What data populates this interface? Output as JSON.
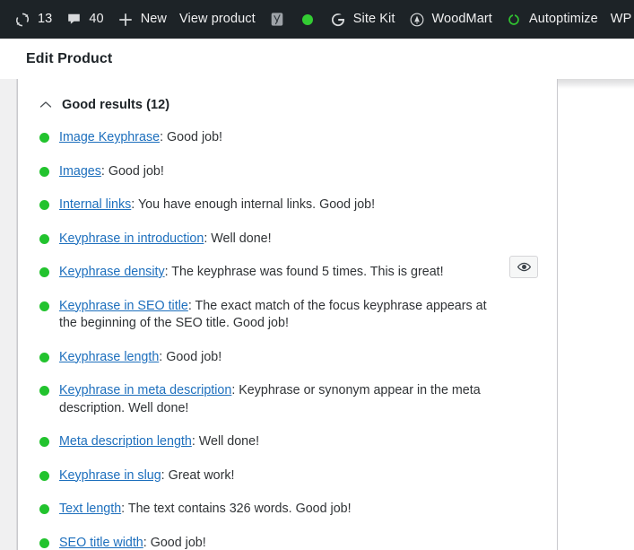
{
  "adminbar": {
    "items": [
      {
        "icon": "wordpress-updates-icon",
        "label": "13",
        "name": "adminbar-updates"
      },
      {
        "icon": "comment-bubble-icon",
        "label": "40",
        "name": "adminbar-comments"
      },
      {
        "icon": "plus-icon",
        "label": "New",
        "name": "adminbar-new"
      },
      {
        "icon": null,
        "label": "View product",
        "name": "adminbar-view-product"
      },
      {
        "icon": "yoast-seo-icon",
        "label": "",
        "name": "adminbar-yoast"
      },
      {
        "icon": "green-dot-icon",
        "label": "",
        "name": "adminbar-seo-score"
      },
      {
        "icon": "google-g-icon",
        "label": "Site Kit",
        "name": "adminbar-site-kit"
      },
      {
        "icon": "woodmart-icon",
        "label": "WoodMart",
        "name": "adminbar-woodmart"
      },
      {
        "icon": "autoptimize-icon",
        "label": "Autoptimize",
        "name": "adminbar-autoptimize"
      },
      {
        "icon": null,
        "label": "WP Rocket",
        "name": "adminbar-wp-rocket"
      }
    ]
  },
  "page": {
    "title": "Edit Product"
  },
  "analysis": {
    "section_title": "Good results (12)",
    "collapse_icon": "chevron-up-icon",
    "bullet_color": "#22c32e",
    "link_color": "#1d6fbd",
    "eye_button_icon": "eye-icon",
    "results": [
      {
        "link": "Image Keyphrase",
        "text": ": Good job!"
      },
      {
        "link": "Images",
        "text": ": Good job!"
      },
      {
        "link": "Internal links",
        "text": ": You have enough internal links. Good job!"
      },
      {
        "link": "Keyphrase in introduction",
        "text": ": Well done!"
      },
      {
        "link": "Keyphrase density",
        "text": ": The keyphrase was found 5 times. This is great!",
        "has_eye_button": true
      },
      {
        "link": "Keyphrase in SEO title",
        "text": ": The exact match of the focus keyphrase appears at the beginning of the SEO title. Good job!"
      },
      {
        "link": "Keyphrase length",
        "text": ": Good job!"
      },
      {
        "link": "Keyphrase in meta description",
        "text": ": Keyphrase or synonym appear in the meta description. Well done!"
      },
      {
        "link": "Meta description length",
        "text": ": Well done!"
      },
      {
        "link": "Keyphrase in slug",
        "text": ": Great work!"
      },
      {
        "link": "Text length",
        "text": ": The text contains 326 words. Good job!"
      },
      {
        "link": "SEO title width",
        "text": ": Good job!"
      }
    ]
  }
}
